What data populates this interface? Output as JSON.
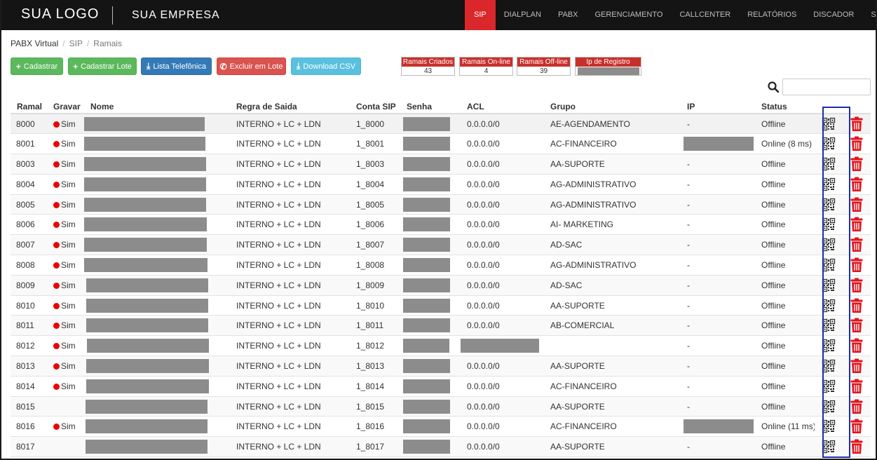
{
  "header": {
    "logo": "SUA LOGO",
    "company": "SUA EMPRESA",
    "nav": [
      "SIP",
      "DIALPLAN",
      "PABX",
      "GERENCIAMENTO",
      "CALLCENTER",
      "RELATÓRIOS",
      "DISCADOR",
      "SAIR"
    ],
    "active_nav": "SIP"
  },
  "breadcrumb": [
    "PABX Virtual",
    "SIP",
    "Ramais"
  ],
  "buttons": {
    "cadastrar": "Cadastrar",
    "cadastrar_lote": "Cadastrar Lote",
    "lista_telefonica": "Lista Telefônica",
    "excluir_lote": "Excluir em Lote",
    "download_csv": "Download CSV"
  },
  "stats": {
    "criados_label": "Ramais Criados",
    "criados_value": "43",
    "online_label": "Ramais On-line",
    "online_value": "4",
    "offline_label": "Ramais Off-line",
    "offline_value": "39",
    "ip_label": "Ip de Registro"
  },
  "search": {
    "value": ""
  },
  "table": {
    "headers": [
      "Ramal",
      "Gravar",
      "Nome",
      "Regra de Saida",
      "Conta SIP",
      "Senha",
      "ACL",
      "Grupo",
      "IP",
      "Status"
    ],
    "rows": [
      {
        "ramal": "8000",
        "gravar": "Sim",
        "regra": "INTERNO + LC + LDN",
        "conta": "1_8000",
        "acl": "0.0.0.0/0",
        "grupo": "AE-AGENDAMENTO",
        "ip": "-",
        "status": "Offline"
      },
      {
        "ramal": "8001",
        "gravar": "Sim",
        "regra": "INTERNO + LC + LDN",
        "conta": "1_8001",
        "acl": "0.0.0.0/0",
        "grupo": "AC-FINANCEIRO",
        "ip": "",
        "status": "Online (8 ms)"
      },
      {
        "ramal": "8003",
        "gravar": "Sim",
        "regra": "INTERNO + LC + LDN",
        "conta": "1_8003",
        "acl": "0.0.0.0/0",
        "grupo": "AA-SUPORTE",
        "ip": "-",
        "status": "Offline"
      },
      {
        "ramal": "8004",
        "gravar": "Sim",
        "regra": "INTERNO + LC + LDN",
        "conta": "1_8004",
        "acl": "0.0.0.0/0",
        "grupo": "AG-ADMINISTRATIVO",
        "ip": "-",
        "status": "Offline"
      },
      {
        "ramal": "8005",
        "gravar": "Sim",
        "regra": "INTERNO + LC + LDN",
        "conta": "1_8005",
        "acl": "0.0.0.0/0",
        "grupo": "AG-ADMINISTRATIVO",
        "ip": "-",
        "status": "Offline"
      },
      {
        "ramal": "8006",
        "gravar": "Sim",
        "regra": "INTERNO + LC + LDN",
        "conta": "1_8006",
        "acl": "0.0.0.0/0",
        "grupo": "AI- MARKETING",
        "ip": "-",
        "status": "Offline"
      },
      {
        "ramal": "8007",
        "gravar": "Sim",
        "regra": "INTERNO + LC + LDN",
        "conta": "1_8007",
        "acl": "0.0.0.0/0",
        "grupo": "AD-SAC",
        "ip": "-",
        "status": "Offline"
      },
      {
        "ramal": "8008",
        "gravar": "Sim",
        "regra": "INTERNO + LC + LDN",
        "conta": "1_8008",
        "acl": "0.0.0.0/0",
        "grupo": "AG-ADMINISTRATIVO",
        "ip": "-",
        "status": "Offline"
      },
      {
        "ramal": "8009",
        "gravar": "Sim",
        "regra": "INTERNO + LC + LDN",
        "conta": "1_8009",
        "acl": "0.0.0.0/0",
        "grupo": "AD-SAC",
        "ip": "-",
        "status": "Offline"
      },
      {
        "ramal": "8010",
        "gravar": "Sim",
        "regra": "INTERNO + LC + LDN",
        "conta": "1_8010",
        "acl": "0.0.0.0/0",
        "grupo": "AA-SUPORTE",
        "ip": "-",
        "status": "Offline"
      },
      {
        "ramal": "8011",
        "gravar": "Sim",
        "regra": "INTERNO + LC + LDN",
        "conta": "1_8011",
        "acl": "0.0.0.0/0",
        "grupo": "AB-COMERCIAL",
        "ip": "-",
        "status": "Offline"
      },
      {
        "ramal": "8012",
        "gravar": "Sim",
        "regra": "INTERNO + LC + LDN",
        "conta": "1_8012",
        "acl": "",
        "grupo": "",
        "ip": "-",
        "status": "Offline"
      },
      {
        "ramal": "8013",
        "gravar": "Sim",
        "regra": "INTERNO + LC + LDN",
        "conta": "1_8013",
        "acl": "0.0.0.0/0",
        "grupo": "AA-SUPORTE",
        "ip": "-",
        "status": "Offline"
      },
      {
        "ramal": "8014",
        "gravar": "Sim",
        "regra": "INTERNO + LC + LDN",
        "conta": "1_8014",
        "acl": "0.0.0.0/0",
        "grupo": "AC-FINANCEIRO",
        "ip": "-",
        "status": "Offline"
      },
      {
        "ramal": "8015",
        "gravar": "",
        "regra": "INTERNO + LC + LDN",
        "conta": "1_8015",
        "acl": "0.0.0.0/0",
        "grupo": "AA-SUPORTE",
        "ip": "-",
        "status": "Offline"
      },
      {
        "ramal": "8016",
        "gravar": "Sim",
        "regra": "INTERNO + LC + LDN",
        "conta": "1_8016",
        "acl": "0.0.0.0/0",
        "grupo": "AC-FINANCEIRO",
        "ip": "",
        "status": "Online (11 ms)"
      },
      {
        "ramal": "8017",
        "gravar": "",
        "regra": "INTERNO + LC + LDN",
        "conta": "1_8017",
        "acl": "0.0.0.0/0",
        "grupo": "AA-SUPORTE",
        "ip": "-",
        "status": "Offline"
      }
    ]
  },
  "colors": {
    "accent": "#d9272b",
    "topbar": "#141414",
    "highlight": "#1f2ea7",
    "redacted": "#8c8c8c"
  },
  "icons": {
    "qr": "qrcode-icon",
    "delete": "trash-icon",
    "search": "search-icon",
    "record": "record-dot-icon"
  }
}
